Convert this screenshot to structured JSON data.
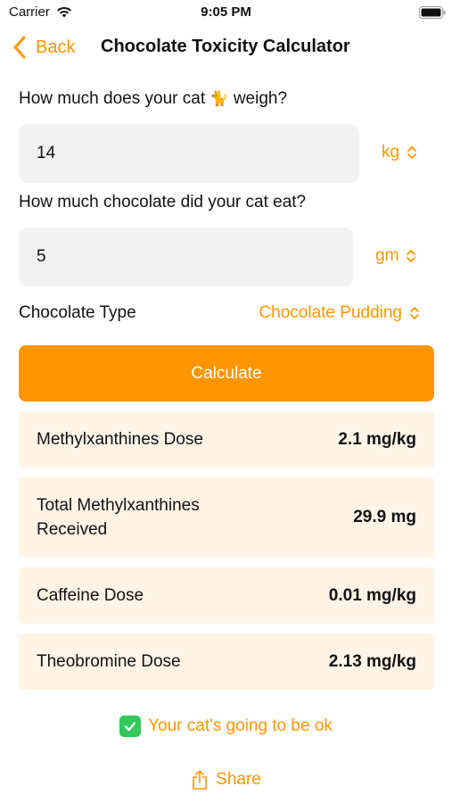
{
  "status_bar": {
    "carrier": "Carrier",
    "time": "9:05 PM"
  },
  "nav": {
    "back_label": "Back",
    "title": "Chocolate Toxicity Calculator"
  },
  "weight": {
    "question_prefix": "How much does your cat",
    "question_emoji": "🐈",
    "question_suffix": "weigh?",
    "value": "14",
    "unit": "kg"
  },
  "chocolate": {
    "question": "How much chocolate did your cat eat?",
    "value": "5",
    "unit": "gm"
  },
  "chocolate_type": {
    "label": "Chocolate Type",
    "value": "Chocolate Pudding"
  },
  "calculate_label": "Calculate",
  "results": [
    {
      "label": "Methylxanthines Dose",
      "value": "2.1 mg/kg"
    },
    {
      "label": "Total Methylxanthines Received",
      "value": "29.9 mg"
    },
    {
      "label": "Caffeine Dose",
      "value": "0.01 mg/kg"
    },
    {
      "label": "Theobromine Dose",
      "value": "2.13 mg/kg"
    }
  ],
  "verdict": "Your cat's going to be ok",
  "share_label": "Share",
  "colors": {
    "accent": "#FF9500",
    "card_bg": "#FFF4E6",
    "input_bg": "#F2F2F2",
    "check_green": "#34C759"
  }
}
